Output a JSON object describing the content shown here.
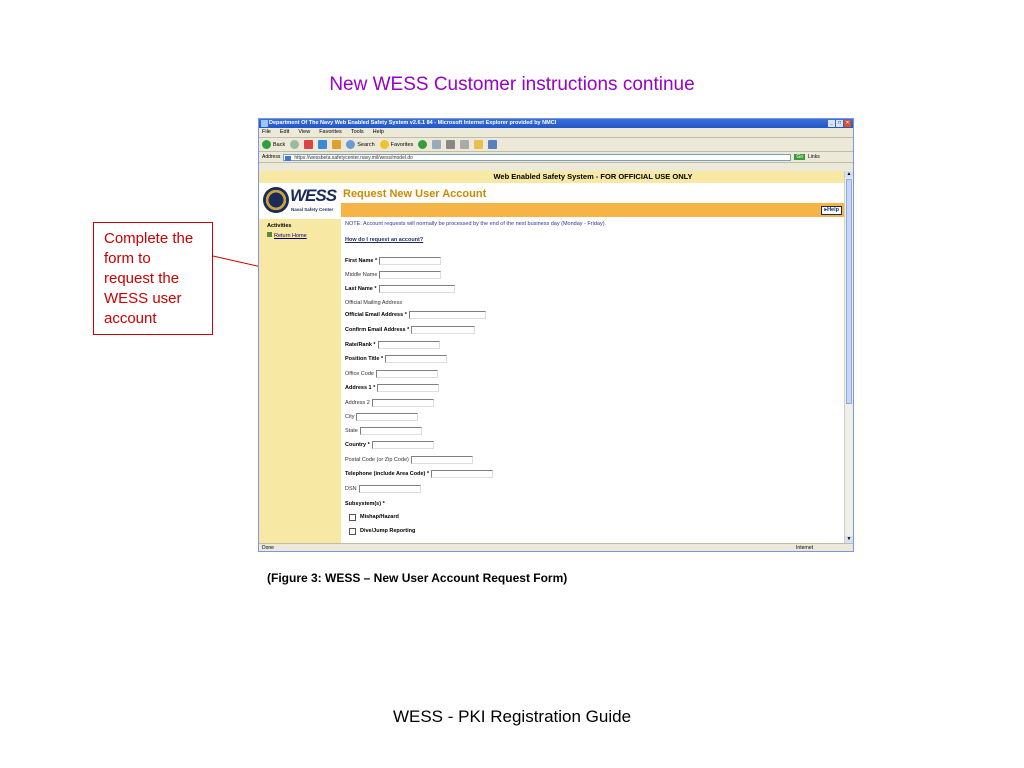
{
  "slide": {
    "title": "New WESS Customer instructions continue",
    "callout": "Complete the form to request the WESS user account",
    "caption": "(Figure 3: WESS – New User Account Request Form)",
    "footer": "WESS - PKI Registration Guide"
  },
  "browser": {
    "window_title": "Department Of The Navy Web Enabled Safety System v2.6.1 84 - Microsoft Internet Explorer provided by NMCI",
    "menus": [
      "File",
      "Edit",
      "View",
      "Favorites",
      "Tools",
      "Help"
    ],
    "toolbar": {
      "back": "Back",
      "search": "Search",
      "favorites": "Favorites"
    },
    "address_label": "Address",
    "address_url": "https://wessbeta.safetycenter.navy.mil/wess/model.do",
    "go_label": "Go",
    "links_label": "Links",
    "status_left": "Done",
    "status_zone": "Internet"
  },
  "site": {
    "banner": "Web Enabled Safety System - FOR OFFICIAL USE ONLY",
    "logo_word": "WESS",
    "logo_sub": "Naval Safety Center",
    "activities_label": "Activities",
    "return_home": "Return Home",
    "heading": "Request New User Account",
    "help_label": "Help"
  },
  "form": {
    "note": "NOTE: Account requests will normally be processed by the end of the next business day (Monday - Friday).",
    "howto_link": "How do I request an account?",
    "fields": [
      {
        "label": "First Name *"
      },
      {
        "label": "Middle Name"
      },
      {
        "label": "Last Name *"
      },
      {
        "label": "Official Mailing Address"
      },
      {
        "label": "Official Email Address *"
      },
      {
        "label": "Confirm Email Address *"
      },
      {
        "label": "Rate/Rank *"
      },
      {
        "label": "Position Title *"
      },
      {
        "label": "Office Code"
      },
      {
        "label": "Address 1 *"
      },
      {
        "label": "Address 2"
      },
      {
        "label": "City"
      },
      {
        "label": "State"
      },
      {
        "label": "Country *"
      },
      {
        "label": "Postal Code (or Zip Code)"
      },
      {
        "label": "Telephone (include Area Code) *"
      },
      {
        "label": "DSN"
      },
      {
        "label": "Subsystem(s) *"
      }
    ],
    "subsystems": [
      "Mishap/Hazard",
      "Dive/Jump Reporting"
    ]
  }
}
